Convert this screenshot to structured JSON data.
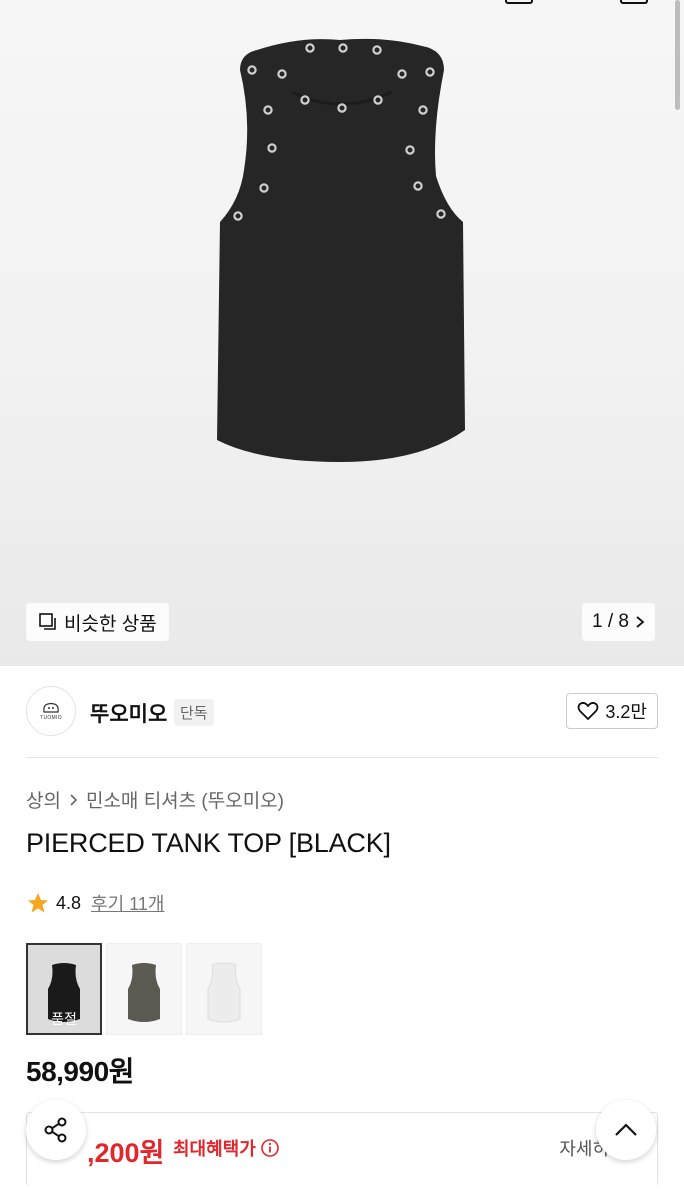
{
  "gallery": {
    "similar_label": "비슷한 상품",
    "counter": "1 / 8"
  },
  "brand": {
    "logo_text": "TUOMIO",
    "name": "뚜오미오",
    "badge": "단독",
    "likes": "3.2만"
  },
  "breadcrumb": [
    "상의",
    "민소매 티셔츠 (뚜오미오)"
  ],
  "product": {
    "title": "PIERCED TANK TOP [BLACK]",
    "rating": "4.8",
    "review_link": "후기 11개",
    "price": "58,990원"
  },
  "color_options": [
    {
      "color": "#1a1a1a",
      "sold_out_label": "품절"
    },
    {
      "color": "#5a5a52",
      "sold_out_label": ""
    },
    {
      "color": "#ececec",
      "sold_out_label": ""
    }
  ],
  "benefit": {
    "price": ",200원",
    "label": "최대혜택가",
    "detail_link": "자세히"
  },
  "colors": {
    "accent_red": "#e2262b",
    "star": "#f5a623"
  },
  "icons": [
    "share-icon",
    "chevron-up-icon",
    "heart-icon",
    "star-icon",
    "info-icon",
    "similar-items-icon",
    "chevron-right-icon"
  ]
}
